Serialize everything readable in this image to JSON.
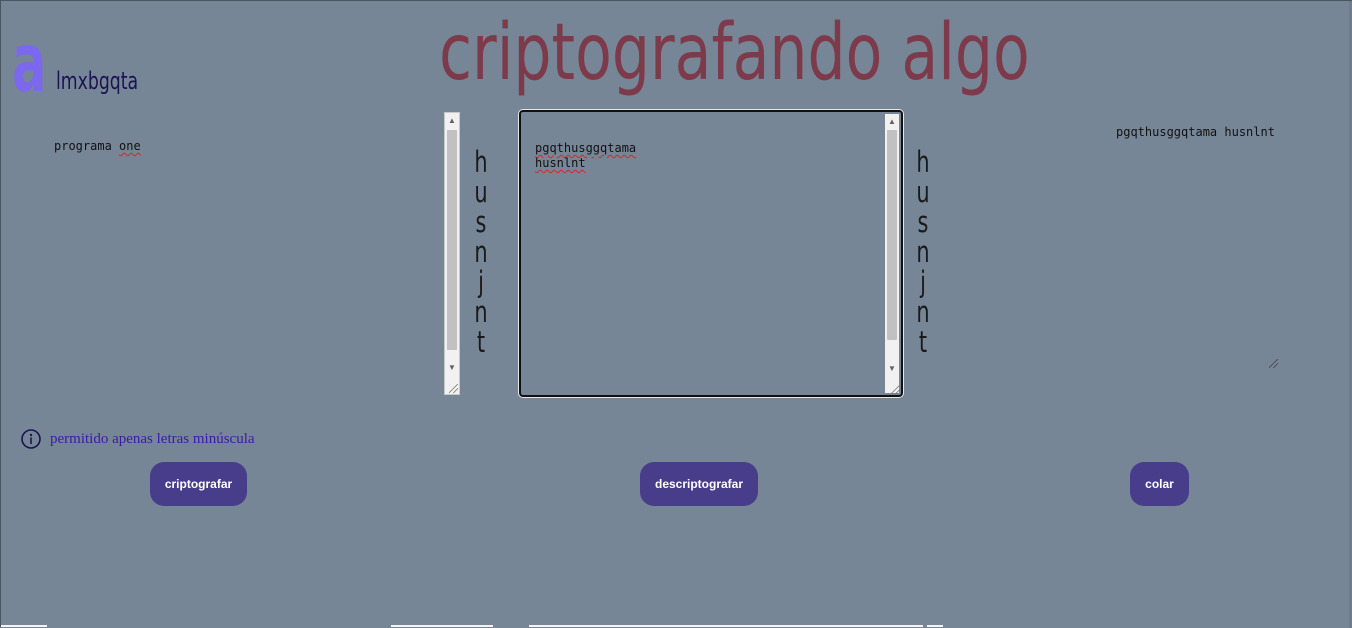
{
  "logo": {
    "mark": "a",
    "word": "lmxbgqta"
  },
  "title": "criptografando algo",
  "input": {
    "value": "programa one"
  },
  "center": {
    "line1": "pgqthusggqtama",
    "line2": "husnlnt"
  },
  "vertical_word": {
    "letters": [
      "h",
      "u",
      "s",
      "n",
      "j",
      "n",
      "t"
    ]
  },
  "output": {
    "value": "pgqthusggqtama husnlnt"
  },
  "hint": {
    "text": "permitido apenas letras minúscula",
    "icon": "info-icon"
  },
  "buttons": {
    "encrypt": "criptografar",
    "decrypt": "descriptografar",
    "paste": "colar"
  },
  "colors": {
    "background": "#778696",
    "title": "#7c3a4a",
    "logo_mark": "#7b68ee",
    "logo_word": "#1a1452",
    "button": "#483d8b",
    "hint": "#3b1aa8"
  }
}
